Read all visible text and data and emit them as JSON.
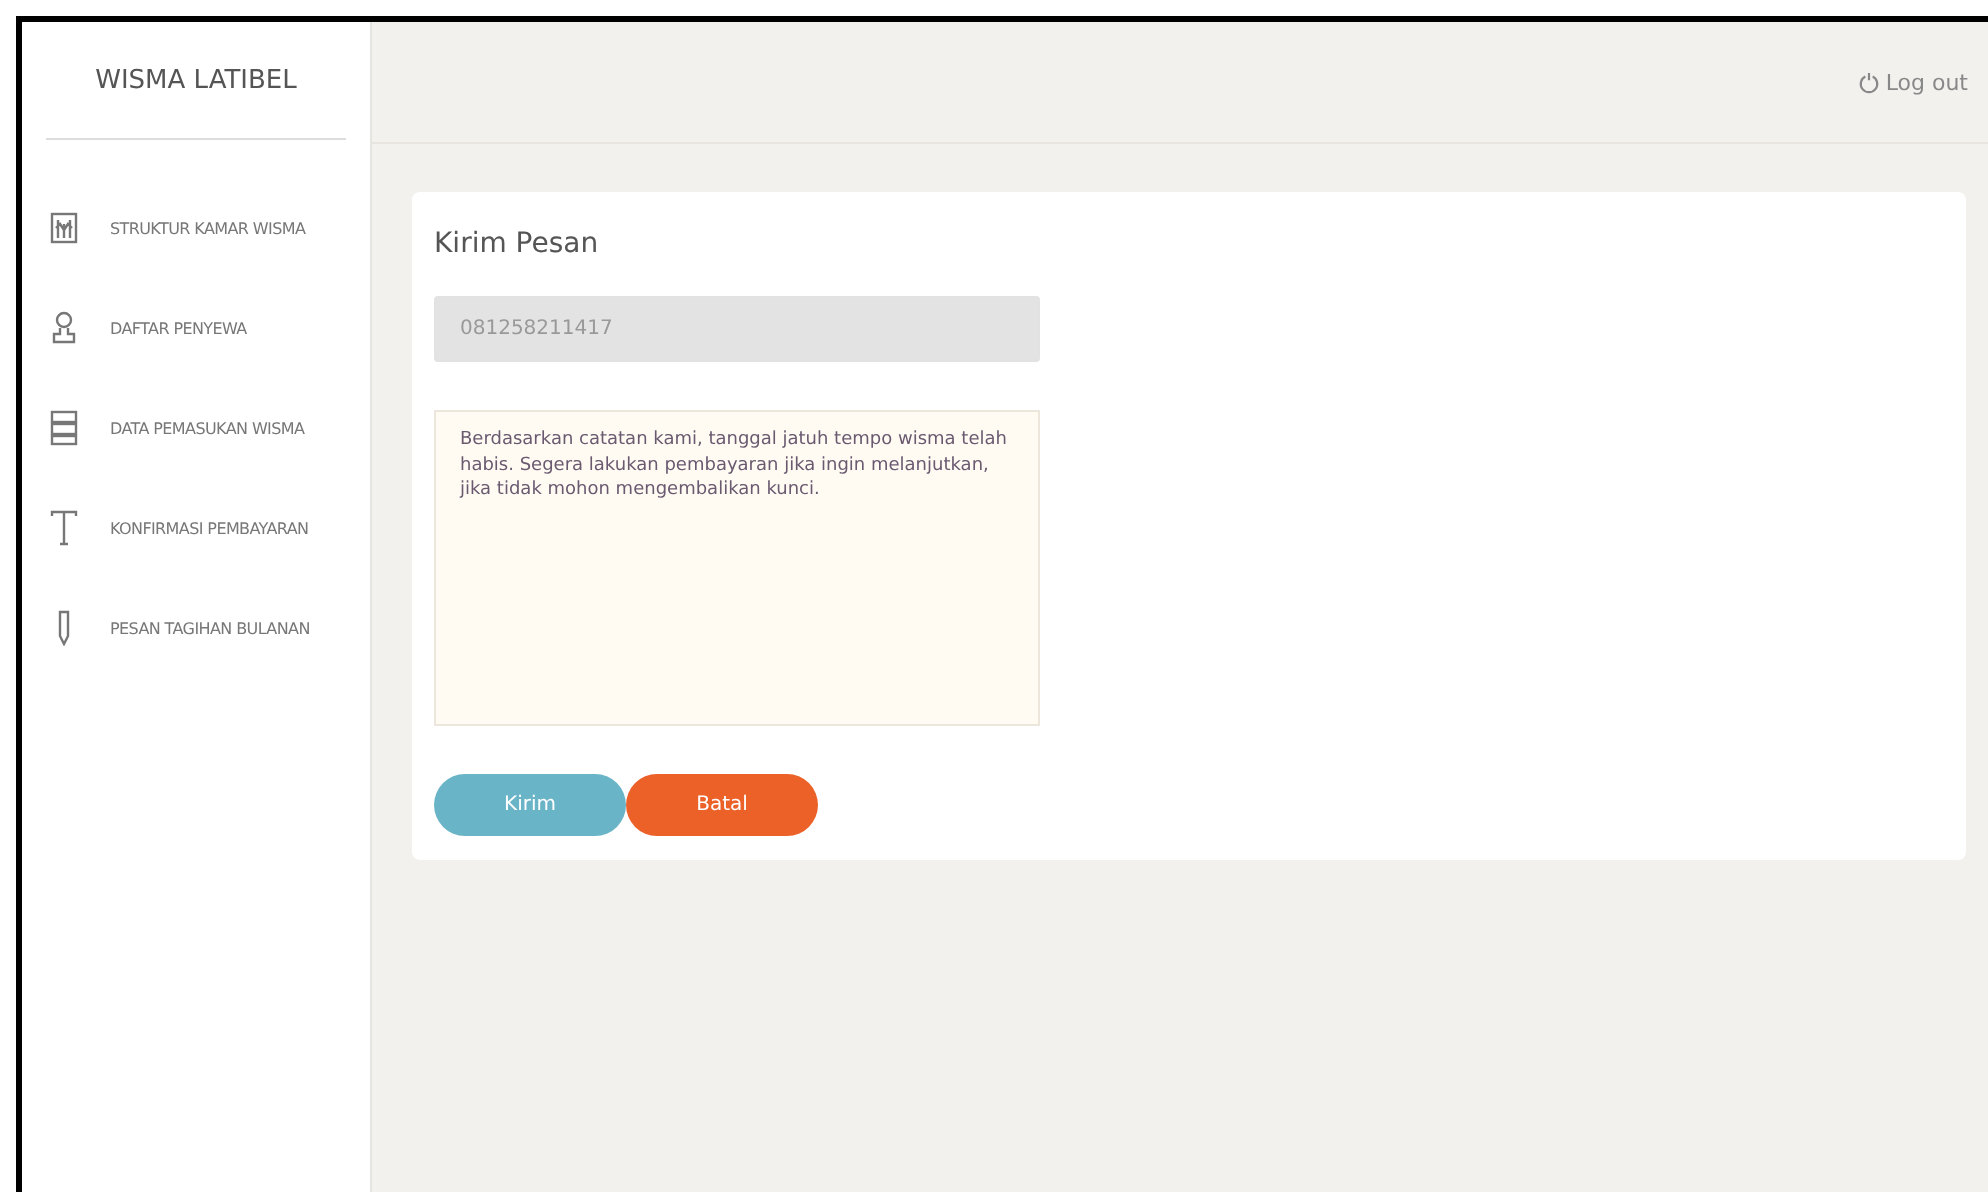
{
  "brand": "WISMA LATIBEL",
  "sidebar": {
    "items": [
      {
        "label": "STRUKTUR KAMAR WISMA",
        "kind": "chart"
      },
      {
        "label": "DAFTAR PENYEWA",
        "kind": "person"
      },
      {
        "label": "DATA PEMASUKAN WISMA",
        "kind": "server"
      },
      {
        "label": "KONFIRMASI PEMBAYARAN",
        "kind": "type"
      },
      {
        "label": "PESAN TAGIHAN BULANAN",
        "kind": "pen"
      }
    ]
  },
  "header": {
    "logout": "Log out"
  },
  "form": {
    "title": "Kirim Pesan",
    "phone": {
      "value": "081258211417",
      "disabled": true
    },
    "message": "Berdasarkan catatan kami, tanggal jatuh tempo wisma telah habis. Segera lakukan pembayaran jika ingin melanjutkan, jika tidak mohon mengembalikan kunci.",
    "buttons": [
      {
        "label": "Kirim",
        "kind": "primary"
      },
      {
        "label": "Batal",
        "kind": "danger"
      }
    ]
  }
}
